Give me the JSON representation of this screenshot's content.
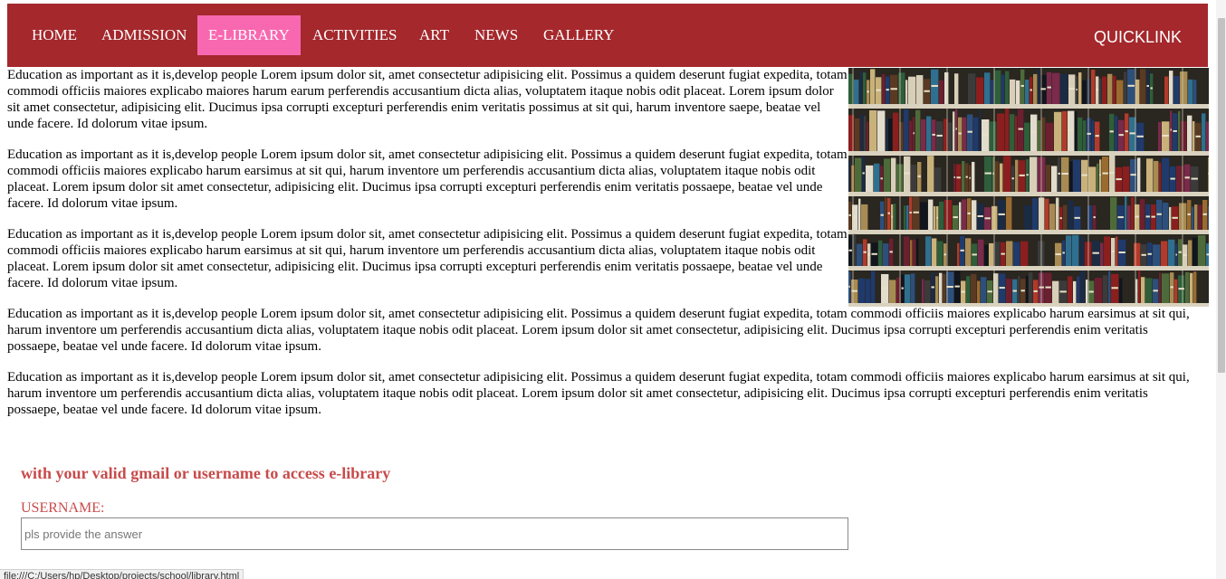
{
  "nav": {
    "items": [
      {
        "label": "HOME",
        "active": false
      },
      {
        "label": "ADMISSION",
        "active": false
      },
      {
        "label": "E-LIBRARY",
        "active": true
      },
      {
        "label": "ACTIVITIES",
        "active": false
      },
      {
        "label": "ART",
        "active": false
      },
      {
        "label": "NEWS",
        "active": false
      },
      {
        "label": "GALLERY",
        "active": false
      }
    ],
    "quicklink": "QUICKLINK"
  },
  "colors": {
    "navbar": "#a4282c",
    "active_tab": "#f868b0",
    "accent_text": "#c84b4b"
  },
  "content": {
    "paragraphs": [
      "Education as important as it is,develop people Lorem ipsum dolor sit, amet consectetur adipisicing elit. Possimus a quidem deserunt fugiat expedita, totam commodi officiis maiores explicabo maiores harum earum perferendis accusantium dicta alias, voluptatem itaque nobis odit placeat. Lorem ipsum dolor sit amet consectetur, adipisicing elit. Ducimus ipsa corrupti excepturi perferendis enim veritatis possimus at sit qui, harum inventore saepe, beatae vel unde facere. Id dolorum vitae ipsum.",
      "Education as important as it is,develop people Lorem ipsum dolor sit, amet consectetur adipisicing elit. Possimus a quidem deserunt fugiat expedita, totam commodi officiis maiores explicabo harum earsimus at sit qui, harum inventore um perferendis accusantium dicta alias, voluptatem itaque nobis odit placeat. Lorem ipsum dolor sit amet consectetur, adipisicing elit. Ducimus ipsa corrupti excepturi perferendis enim veritatis possaepe, beatae vel unde facere. Id dolorum vitae ipsum.",
      "Education as important as it is,develop people Lorem ipsum dolor sit, amet consectetur adipisicing elit. Possimus a quidem deserunt fugiat expedita, totam commodi officiis maiores explicabo harum earsimus at sit qui, harum inventore um perferendis accusantium dicta alias, voluptatem itaque nobis odit placeat. Lorem ipsum dolor sit amet consectetur, adipisicing elit. Ducimus ipsa corrupti excepturi perferendis enim veritatis possaepe, beatae vel unde facere. Id dolorum vitae ipsum.",
      "Education as important as it is,develop people Lorem ipsum dolor sit, amet consectetur adipisicing elit. Possimus a quidem deserunt fugiat expedita, totam commodi officiis maiores explicabo harum earsimus at sit qui, harum inventore um perferendis accusantium dicta alias, voluptatem itaque nobis odit placeat. Lorem ipsum dolor sit amet consectetur, adipisicing elit. Ducimus ipsa corrupti excepturi perferendis enim veritatis possaepe, beatae vel unde facere. Id dolorum vitae ipsum.",
      "Education as important as it is,develop people Lorem ipsum dolor sit, amet consectetur adipisicing elit. Possimus a quidem deserunt fugiat expedita, totam commodi officiis maiores explicabo harum earsimus at sit qui, harum inventore um perferendis accusantium dicta alias, voluptatem itaque nobis odit placeat. Lorem ipsum dolor sit amet consectetur, adipisicing elit. Ducimus ipsa corrupti excepturi perferendis enim veritatis possaepe, beatae vel unde facere. Id dolorum vitae ipsum."
    ]
  },
  "login": {
    "heading": "with your valid gmail or username to access e-library",
    "username_label": "USERNAME:",
    "username_value": "",
    "username_placeholder": "pls provide the answer"
  },
  "status_bar": {
    "url": "file:///C:/Users/hp/Desktop/projects/school/library.html"
  }
}
